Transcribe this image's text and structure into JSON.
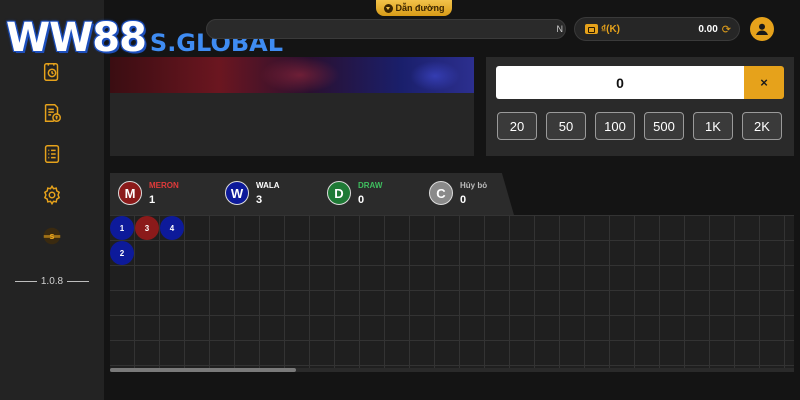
{
  "logo": {
    "brand": "WW88",
    "suffix": "S.GLOBAL"
  },
  "header": {
    "guide_label": "Dẫn đường",
    "marquee_text": "N",
    "currency_unit": "₫(K)",
    "balance": "0.00"
  },
  "sidebar": {
    "icons": [
      "history-icon",
      "money-history-icon",
      "bet-list-icon",
      "settings-icon",
      "game-logo-icon"
    ],
    "version": "1.0.8"
  },
  "bet_panel": {
    "amount": "0",
    "clear_label": "×",
    "chips": [
      "20",
      "50",
      "100",
      "500",
      "1K",
      "2K"
    ]
  },
  "scoreboard": {
    "stats": [
      {
        "letter": "M",
        "label": "MERON",
        "count": "1",
        "color": "#8b1a1a",
        "label_color": "#e03a3a"
      },
      {
        "letter": "W",
        "label": "WALA",
        "count": "3",
        "color": "#0d1a9a",
        "label_color": "#ffffff"
      },
      {
        "letter": "D",
        "label": "DRAW",
        "count": "0",
        "color": "#1f7a36",
        "label_color": "#3fbf5f"
      },
      {
        "letter": "C",
        "label": "Hủy bỏ",
        "count": "0",
        "color": "#8a8a8a",
        "label_color": "#bdbdbd"
      }
    ],
    "beads": [
      {
        "num": "1",
        "result": "wala",
        "col": 0,
        "row": 0
      },
      {
        "num": "2",
        "result": "wala",
        "col": 0,
        "row": 1
      },
      {
        "num": "3",
        "result": "meron",
        "col": 1,
        "row": 0
      },
      {
        "num": "4",
        "result": "wala",
        "col": 2,
        "row": 0
      }
    ]
  },
  "colors": {
    "accent": "#e6a21b",
    "meron": "#8b1a1a",
    "wala": "#0d1a9a"
  }
}
